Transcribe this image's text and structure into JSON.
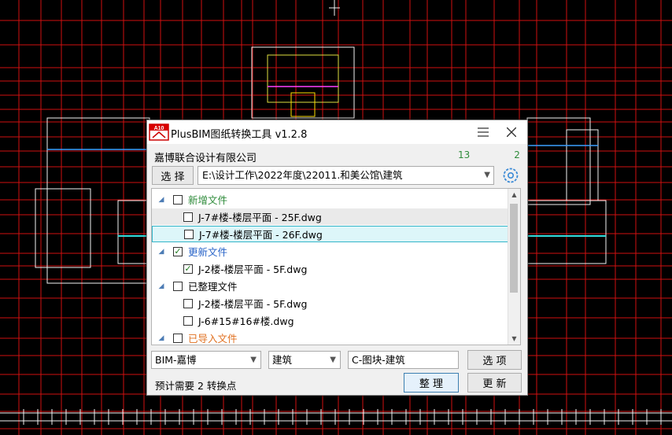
{
  "window": {
    "title": "PlusBIM图纸转换工具 v1.2.8",
    "icon_label": "A10",
    "menu_icon": "hamburger-icon",
    "close_icon": "close-icon"
  },
  "header": {
    "company": "嘉博联合设计有限公司",
    "phone_partial_left": "13",
    "phone_partial_right": "2"
  },
  "path_bar": {
    "select_label": "选 择",
    "path_value": "E:\\设计工作\\2022年度\\22011.和美公馆\\建筑",
    "settings_icon": "gear-icon"
  },
  "file_tree": {
    "groups": [
      {
        "label": "新增文件",
        "color": "#2e8b3a",
        "checked": false,
        "items": [
          {
            "label": "J-7#楼-楼层平面 - 25F.dwg",
            "checked": false
          },
          {
            "label": "J-7#楼-楼层平面 - 26F.dwg",
            "checked": false
          }
        ]
      },
      {
        "label": "更新文件",
        "color": "#2763c8",
        "checked": true,
        "items": [
          {
            "label": "J-2楼-楼层平面 - 5F.dwg",
            "checked": true
          }
        ]
      },
      {
        "label": "已整理文件",
        "color": "#000000",
        "checked": false,
        "items": [
          {
            "label": "J-2楼-楼层平面 - 5F.dwg",
            "checked": false
          },
          {
            "label": "J-6#15#16#楼.dwg",
            "checked": false
          }
        ]
      },
      {
        "label": "已导入文件",
        "color": "#e07020",
        "checked": false,
        "items": []
      }
    ]
  },
  "bottom": {
    "project_combo": "BIM-嘉博",
    "discipline_combo": "建筑",
    "block_field": "C-图块-建筑",
    "options_label": "选 项",
    "status_text": "预计需要 2 转换点",
    "organize_label": "整 理",
    "update_label": "更 新"
  },
  "colors": {
    "cad_background": "#000000",
    "cad_grid": "#d01010",
    "accent": "#33b5c9"
  }
}
